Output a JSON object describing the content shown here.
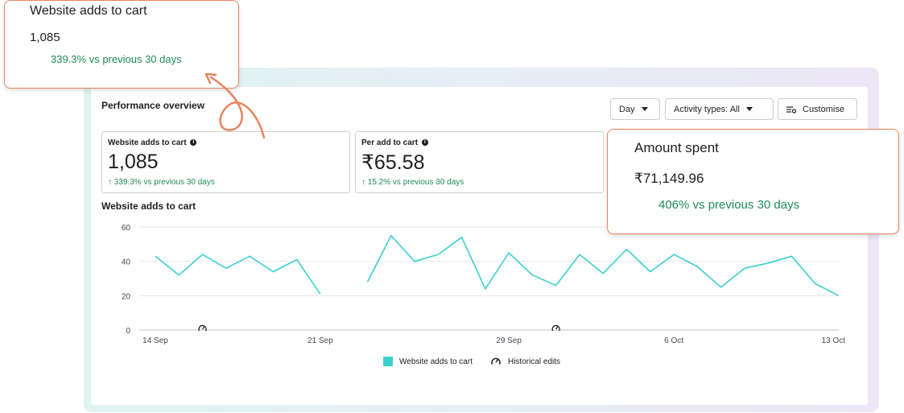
{
  "panel": {
    "title": "Performance overview",
    "controls": {
      "day": "Day",
      "activity": "Activity types: All",
      "customise": "Customise"
    }
  },
  "cards": [
    {
      "label": "Website adds to cart",
      "value": "1,085",
      "change": "↑ 339.3% vs previous 30 days"
    },
    {
      "label": "Per add to cart",
      "value": "₹65.58",
      "change": "↑ 15.2% vs previous 30 days"
    }
  ],
  "callouts": {
    "adds": {
      "label": "Website adds to cart",
      "value": "1,085",
      "change": "339.3% vs previous 30 days"
    },
    "spent": {
      "label": "Amount spent",
      "value": "₹71,149.96",
      "change": "406% vs previous 30 days"
    }
  },
  "colors": {
    "series": "#3ccfcf",
    "positive": "#1e8a5a",
    "callout_border": "#e8845e"
  },
  "chart_data": {
    "type": "line",
    "title": "Website adds to cart",
    "x_tick_labels": [
      "14 Sep",
      "21 Sep",
      "29 Sep",
      "6 Oct",
      "13 Oct"
    ],
    "x_tick_days": [
      0,
      7,
      15,
      22,
      29
    ],
    "ylim": [
      0,
      60
    ],
    "yticks": [
      0,
      20,
      40,
      60
    ],
    "grid": true,
    "series": [
      {
        "name": "Website adds to cart",
        "segments": [
          [
            [
              0,
              43
            ],
            [
              1,
              32
            ],
            [
              2,
              44
            ],
            [
              3,
              36
            ],
            [
              4,
              43
            ],
            [
              5,
              34
            ],
            [
              6,
              41
            ],
            [
              7,
              21
            ]
          ],
          [
            [
              9,
              28
            ],
            [
              10,
              55
            ],
            [
              11,
              40
            ],
            [
              12,
              44
            ],
            [
              13,
              54
            ],
            [
              14,
              24
            ],
            [
              15,
              45
            ],
            [
              16,
              32
            ],
            [
              17,
              26
            ],
            [
              18,
              44
            ],
            [
              19,
              33
            ],
            [
              20,
              47
            ],
            [
              21,
              34
            ],
            [
              22,
              44
            ],
            [
              23,
              37
            ],
            [
              24,
              25
            ],
            [
              25,
              36
            ],
            [
              26,
              39
            ],
            [
              27,
              43
            ],
            [
              28,
              27
            ],
            [
              29,
              20
            ]
          ]
        ]
      }
    ],
    "historical_edit_days": [
      2,
      17
    ],
    "legend": {
      "series_label": "Website adds to cart",
      "edits_label": "Historical edits",
      "placement": "bottom"
    }
  }
}
